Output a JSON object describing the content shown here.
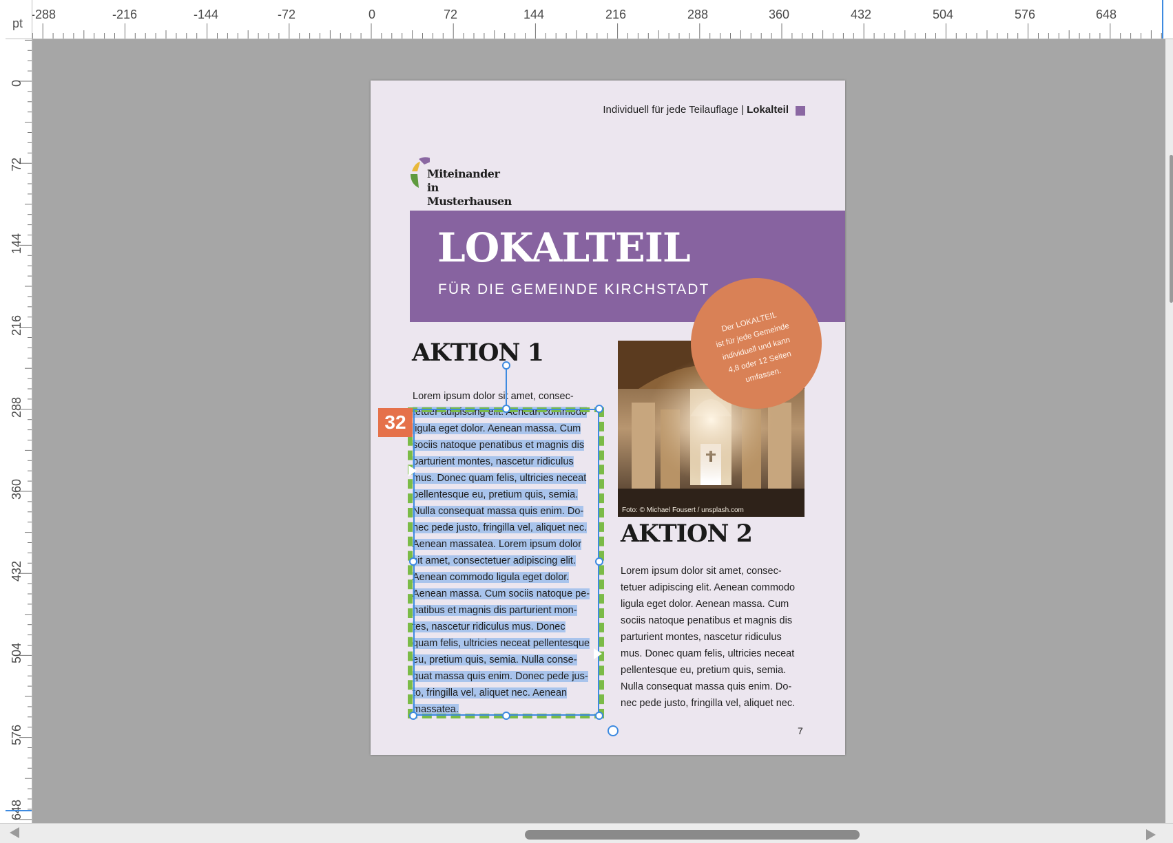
{
  "ruler": {
    "unit": "pt",
    "top_ticks": [
      "-288",
      "-216",
      "-144",
      "-72",
      "0",
      "72",
      "144",
      "216",
      "288",
      "360",
      "432",
      "504",
      "576",
      "648"
    ],
    "left_ticks": [
      "0",
      "72",
      "144",
      "216",
      "288",
      "360",
      "432",
      "504",
      "576",
      "648"
    ]
  },
  "frame_badge": "32",
  "page": {
    "header_prefix": "Individuell für jede Teilauflage | ",
    "header_bold": "Lokalteil",
    "logo_lines": [
      "Miteinander",
      "in Musterhausen"
    ],
    "banner_title": "LOKALTEIL",
    "banner_subtitle": "FÜR DIE GEMEINDE KIRCHSTADT",
    "circle_lines": [
      "Der LOKALTEIL",
      "ist für jede Gemeinde",
      "individuell und kann",
      "4,8 oder 12 Seiten",
      "umfassen."
    ],
    "photo_credit": "Foto: © Michael Fousert / unsplash.com",
    "aktion1": {
      "heading": "AKTION 1",
      "first_line": "Lorem ipsum dolor sit amet, consec-",
      "lines": [
        "tetuer adipiscing elit. Aenean commodo",
        "ligula eget dolor. Aenean massa. Cum",
        "sociis natoque penatibus et magnis dis",
        "parturient montes, nascetur ridiculus",
        "mus. Donec quam felis, ultricies neceat",
        "pellentesque eu, pretium quis, semia.",
        "Nulla consequat massa quis enim. Do-",
        "nec pede justo, fringilla vel, aliquet nec.",
        "Aenean massatea. Lorem ipsum dolor",
        "sit amet, consectetuer adipiscing elit.",
        "Aenean commodo ligula eget dolor.",
        "Aenean massa. Cum sociis natoque pe-",
        "natibus et magnis dis parturient mon-",
        "tes, nascetur ridiculus mus. Donec",
        "quam felis, ultricies neceat pellentesque",
        "eu, pretium quis, semia. Nulla conse-",
        "quat massa quis enim. Donec pede jus-",
        "to, fringilla vel, aliquet nec. Aenean",
        "massatea."
      ]
    },
    "aktion2": {
      "heading": "AKTION 2",
      "lines": [
        "Lorem ipsum dolor sit amet, consec-",
        "tetuer adipiscing elit. Aenean commodo",
        "ligula eget dolor. Aenean massa. Cum",
        "sociis natoque penatibus et magnis dis",
        "parturient montes, nascetur ridiculus",
        "mus. Donec quam felis, ultricies neceat",
        "pellentesque eu, pretium quis, semia.",
        "Nulla consequat massa quis enim. Do-",
        "nec pede justo, fringilla vel, aliquet nec."
      ]
    },
    "page_number": "7"
  },
  "colors": {
    "pasteboard": "#a6a6a6",
    "page": "#ece6ef",
    "banner": "#8763a0",
    "circle": "#d98156",
    "selection": "#a9c4ec",
    "frame_dash": "#7bbb47",
    "frame_border": "#3d8ae0",
    "badge": "#e5714a"
  }
}
